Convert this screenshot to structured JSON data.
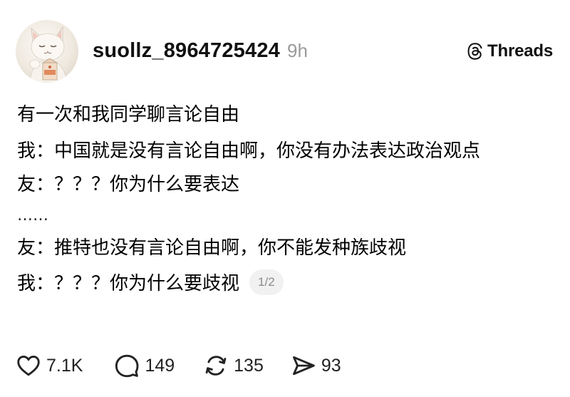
{
  "post": {
    "username": "suollz_8964725424",
    "time": "9h",
    "brand": "Threads",
    "lines": [
      "有一次和我同学聊言论自由",
      "我：中国就是没有言论自由啊，你没有办法表达政治观点",
      "友：？？？你为什么要表达",
      "……",
      "友：推特也没有言论自由啊，你不能发种族歧视",
      "我：？？？你为什么要歧视"
    ],
    "page_indicator": "1/2"
  },
  "actions": {
    "likes": "7.1K",
    "replies": "149",
    "reposts": "135",
    "shares": "93"
  },
  "icons": {
    "avatar": "cat-avatar",
    "brand": "threads-logo-icon",
    "like": "heart-icon",
    "reply": "comment-bubble-icon",
    "repost": "repost-arrows-icon",
    "share": "send-icon"
  }
}
